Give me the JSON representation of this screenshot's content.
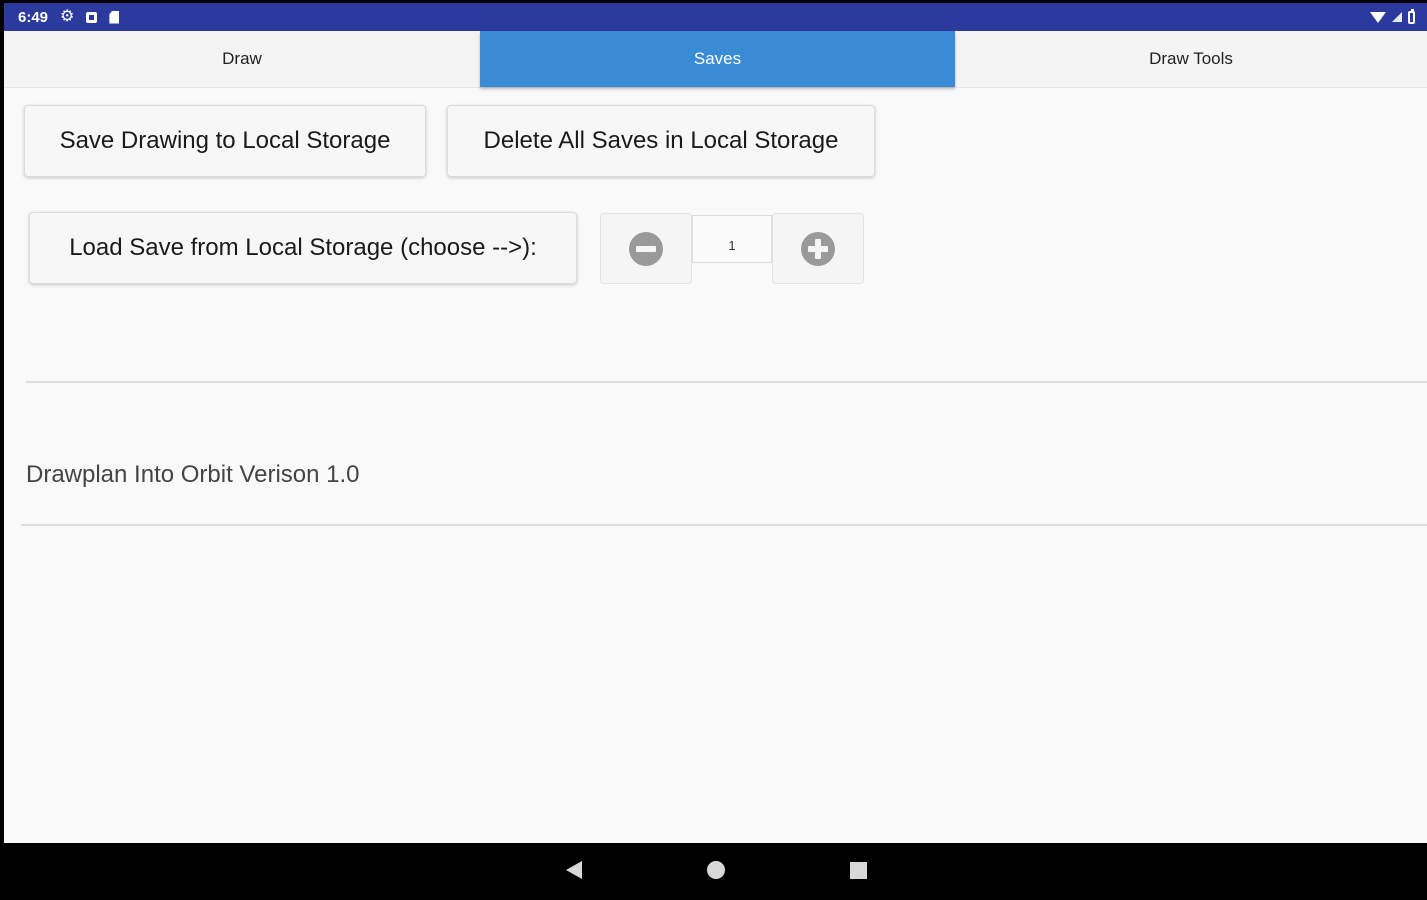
{
  "status_bar": {
    "time": "6:49",
    "icons": [
      "gear-icon",
      "box-icon",
      "sd-card-icon",
      "wifi-icon",
      "signal-icon",
      "battery-icon"
    ],
    "color": "#2b3a9c"
  },
  "tabs": [
    {
      "label": "Draw",
      "selected": false
    },
    {
      "label": "Saves",
      "selected": true
    },
    {
      "label": "Draw Tools",
      "selected": false
    }
  ],
  "actions": {
    "save_label": "Save Drawing to Local Storage",
    "delete_label": "Delete All Saves in Local Storage",
    "load_label": "Load Save from Local Storage (choose -->):"
  },
  "stepper": {
    "value": "1",
    "minus_icon": "minus-circle-icon",
    "plus_icon": "plus-circle-icon"
  },
  "footer": {
    "version_text": "Drawplan Into Orbit Verison 1.0"
  },
  "colors": {
    "accent": "#3a8bd6",
    "background": "#f9f9f9"
  }
}
